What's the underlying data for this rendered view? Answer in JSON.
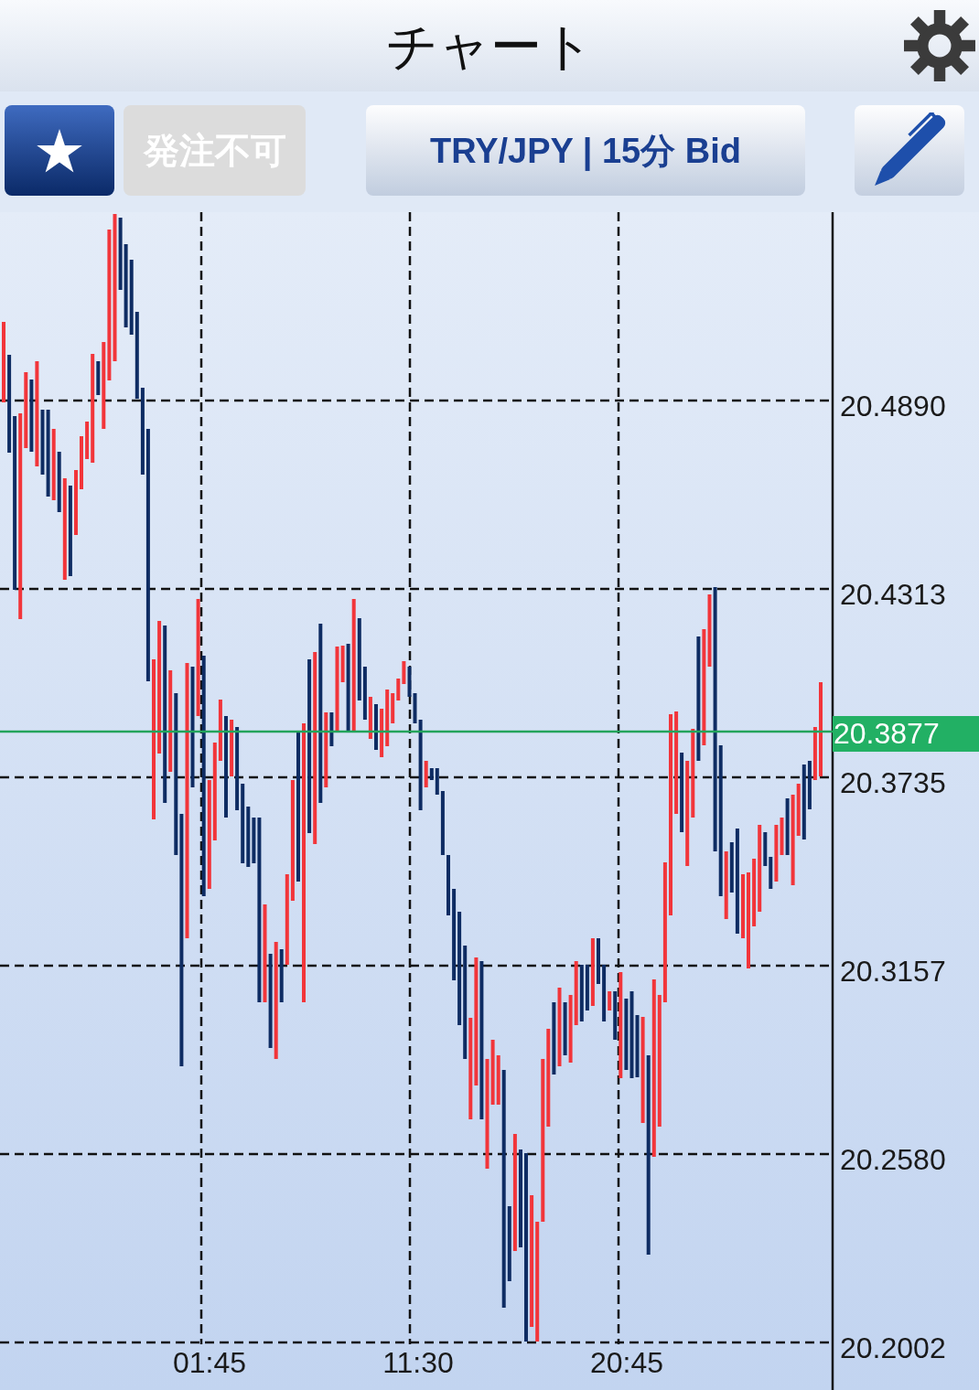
{
  "header": {
    "title": "チャート"
  },
  "toolbar": {
    "order_button": {
      "label": "発注不可",
      "disabled": true
    },
    "instrument_button": {
      "label": "TRY/JPY | 15分 Bid"
    }
  },
  "chart": {
    "price_labels": [
      "20.4890",
      "20.4313",
      "20.3735",
      "20.3157",
      "20.2580",
      "20.2002"
    ],
    "time_labels": [
      "01:45",
      "11:30",
      "20:45"
    ],
    "current_price": "20.3877"
  }
}
